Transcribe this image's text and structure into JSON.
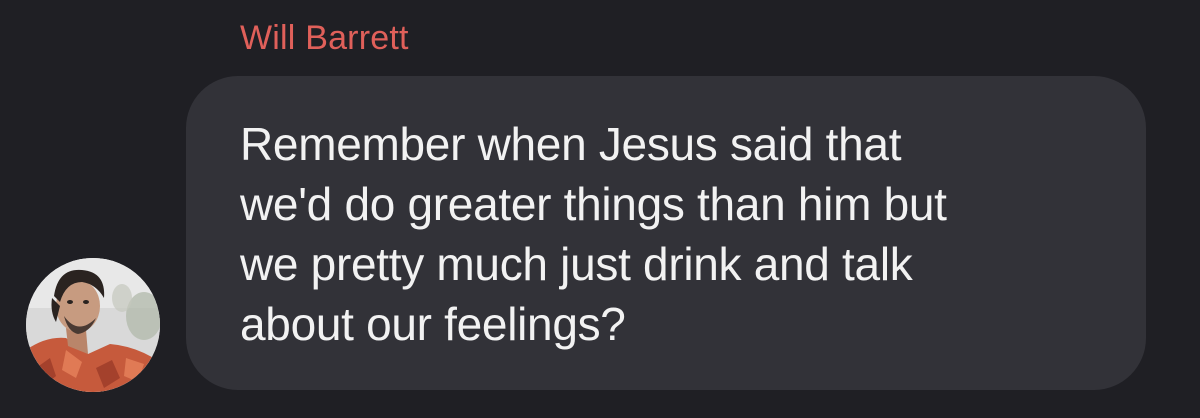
{
  "message": {
    "sender": "Will Barrett",
    "text": "Remember when Jesus said that\nwe'd do greater things than him but\nwe pretty much just drink and talk\nabout our feelings?",
    "avatar_icon": "user-avatar-photo"
  },
  "colors": {
    "background": "#1f1f24",
    "bubble": "#323238",
    "sender_name": "#e0605a",
    "message_text": "#f2f2f2"
  }
}
